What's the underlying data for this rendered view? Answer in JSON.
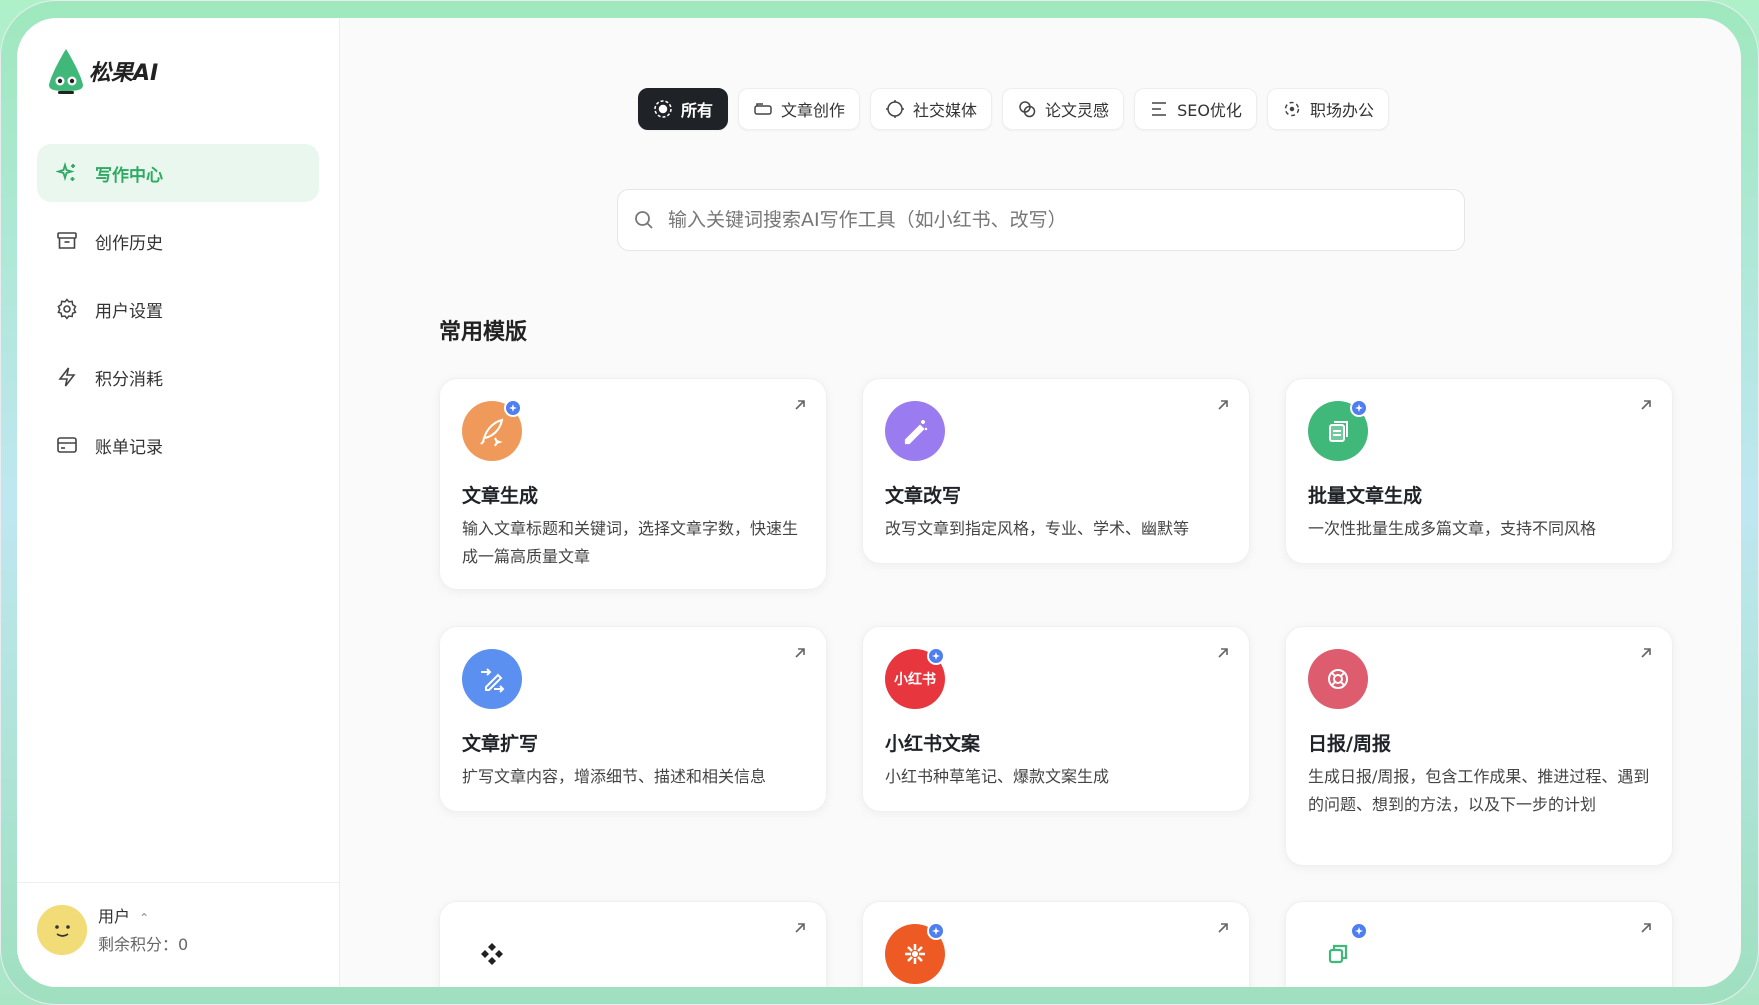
{
  "app": {
    "name": "松果AI"
  },
  "sidebar": {
    "items": [
      {
        "label": "写作中心",
        "icon": "sparkle-icon",
        "active": true
      },
      {
        "label": "创作历史",
        "icon": "archive-icon",
        "active": false
      },
      {
        "label": "用户设置",
        "icon": "gear-icon",
        "active": false
      },
      {
        "label": "积分消耗",
        "icon": "lightning-icon",
        "active": false
      },
      {
        "label": "账单记录",
        "icon": "credit-card-icon",
        "active": false
      }
    ],
    "user": {
      "name": "用户",
      "credits_label": "剩余积分：0"
    }
  },
  "tabs": [
    {
      "label": "所有",
      "icon": "target-icon",
      "active": true
    },
    {
      "label": "文章创作",
      "icon": "card-icon",
      "active": false
    },
    {
      "label": "社交媒体",
      "icon": "circle-icon",
      "active": false
    },
    {
      "label": "论文灵感",
      "icon": "rings-icon",
      "active": false
    },
    {
      "label": "SEO优化",
      "icon": "lines-icon",
      "active": false
    },
    {
      "label": "职场办公",
      "icon": "dashed-circle-icon",
      "active": false
    }
  ],
  "search": {
    "placeholder": "输入关键词搜索AI写作工具（如小红书、改写）"
  },
  "section": {
    "title": "常用模版"
  },
  "cards": [
    {
      "title": "文章生成",
      "desc": "输入文章标题和关键词，选择文章字数，快速生成一篇高质量文章",
      "icon": "quill-icon",
      "color": "#ef9a5a",
      "badge": true
    },
    {
      "title": "文章改写",
      "desc": "改写文章到指定风格，专业、学术、幽默等",
      "icon": "magic-pen-icon",
      "color": "#9b7cf0",
      "badge": false
    },
    {
      "title": "批量文章生成",
      "desc": "一次性批量生成多篇文章，支持不同风格",
      "icon": "documents-icon",
      "color": "#3fb87a",
      "badge": true
    },
    {
      "title": "文章扩写",
      "desc": "扩写文章内容，增添细节、描述和相关信息",
      "icon": "expand-pen-icon",
      "color": "#5b8ff0",
      "badge": false
    },
    {
      "title": "小红书文案",
      "desc": "小红书种草笔记、爆款文案生成",
      "icon": "xiaohongshu-icon",
      "icon_text": "小红书",
      "color": "#e8363f",
      "badge": true
    },
    {
      "title": "日报/周报",
      "desc": "生成日报/周报，包含工作成果、推进过程、遇到的问题、想到的方法，以及下一步的计划",
      "icon": "lifebuoy-icon",
      "color": "#dd5c6e",
      "badge": false
    },
    {
      "title": "",
      "desc": "",
      "icon": "diamond-icon",
      "color": "#ffffff",
      "badge": false
    },
    {
      "title": "",
      "desc": "",
      "icon": "flower-icon",
      "color": "#ee5a24",
      "badge": true
    },
    {
      "title": "",
      "desc": "",
      "icon": "copy-icon",
      "color": "#ffffff",
      "badge": true
    }
  ]
}
